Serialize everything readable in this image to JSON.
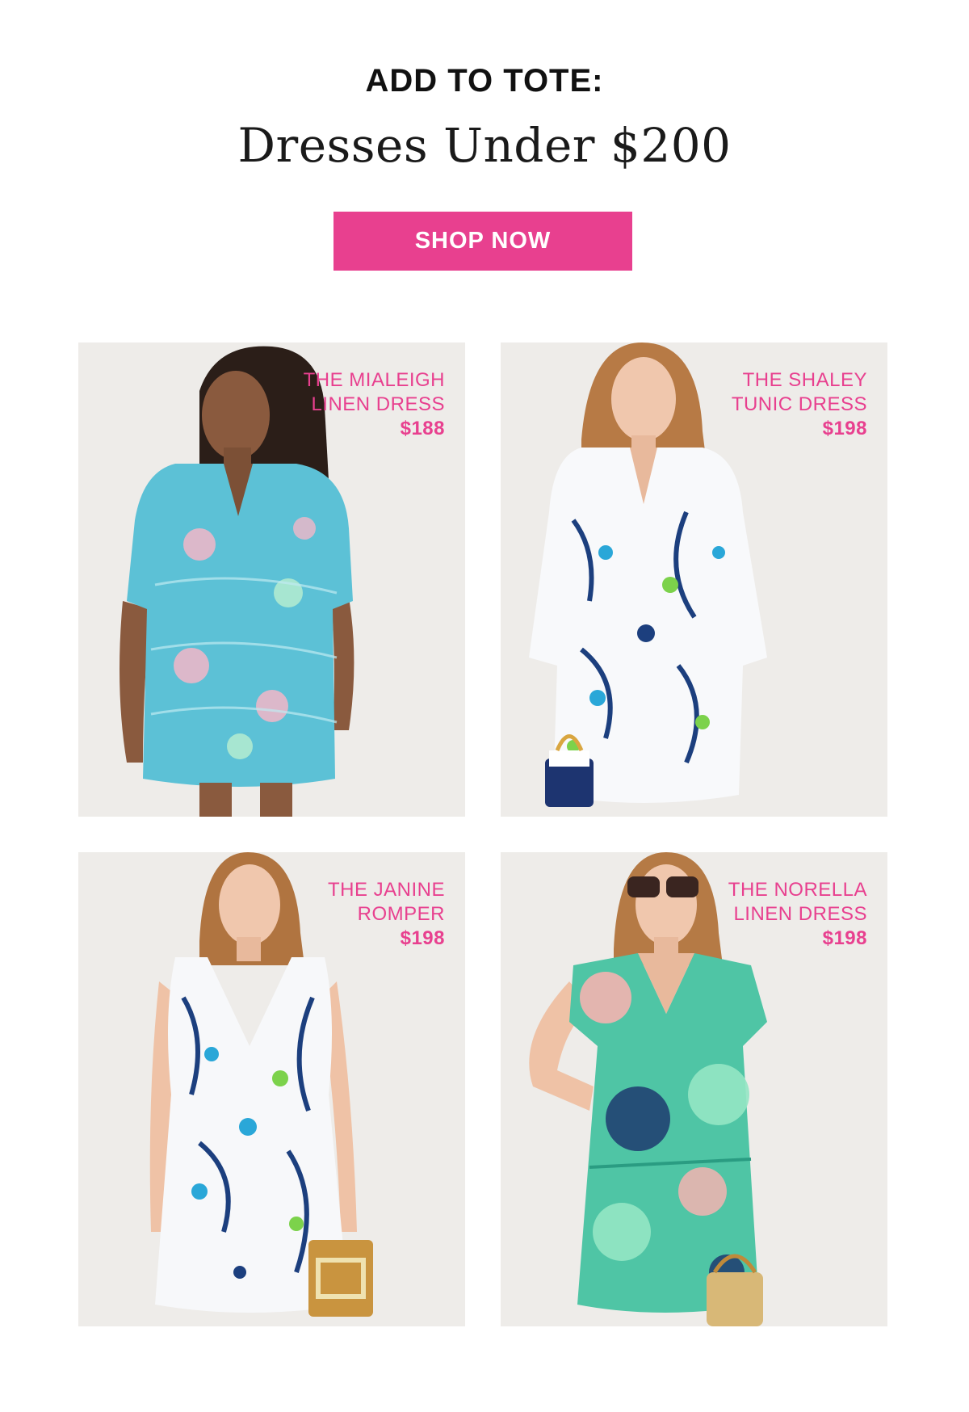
{
  "header": {
    "kicker": "ADD TO TOTE:",
    "headline": "Dresses Under $200",
    "cta_label": "SHOP NOW"
  },
  "colors": {
    "accent": "#e8408f",
    "card_background": "#efedea",
    "text": "#111111"
  },
  "products": [
    {
      "name": "THE MIALEIGH\nLINEN DRESS",
      "price": "$188"
    },
    {
      "name": "THE SHALEY\nTUNIC DRESS",
      "price": "$198"
    },
    {
      "name": "THE JANINE\nROMPER",
      "price": "$198"
    },
    {
      "name": "THE NORELLA\nLINEN DRESS",
      "price": "$198"
    }
  ]
}
